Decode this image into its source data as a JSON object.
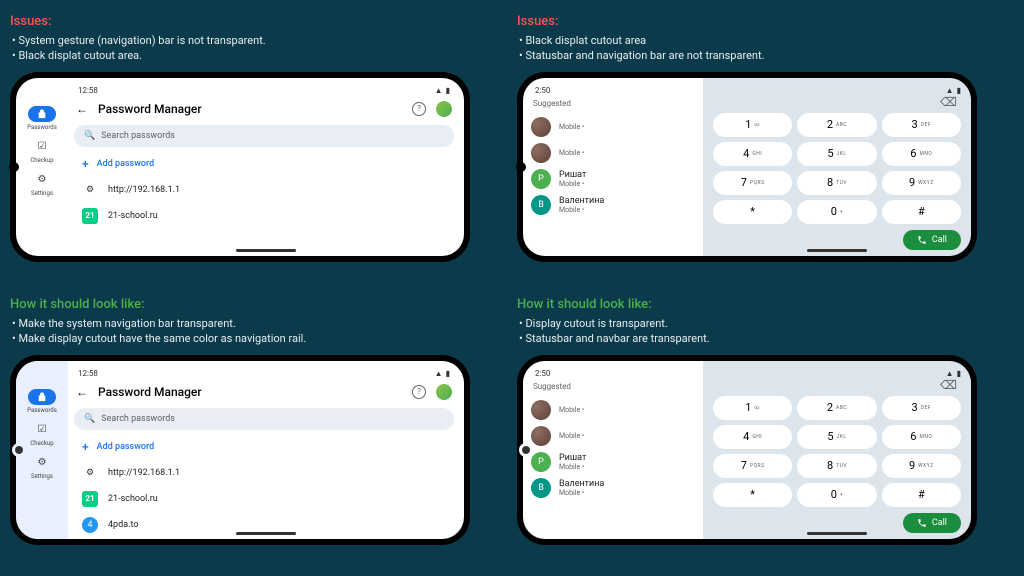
{
  "q1": {
    "heading": "Issues",
    "bullets": [
      "System gesture (navigation) bar is not transparent.",
      "Black displat cutout area."
    ]
  },
  "q2": {
    "heading": "Issues",
    "bullets": [
      "Black displat cutout area",
      "Statusbar and navigation bar are not transparent."
    ]
  },
  "q3": {
    "heading": "How it should look like",
    "bullets": [
      "Make the system navigation bar transparent.",
      "Make display cutout have the same color as navigation rail."
    ]
  },
  "q4": {
    "heading": "How it should look like",
    "bullets": [
      "Display cutout is transparent.",
      "Statusbar and navbar are transparent."
    ]
  },
  "pwdApp": {
    "time": "12:58",
    "title": "Password Manager",
    "search": "Search passwords",
    "add": "Add password",
    "rail": {
      "item1": "Passwords",
      "item2": "Checkup",
      "item3": "Settings"
    },
    "items": [
      {
        "name": "http://192.168.1.1"
      },
      {
        "name": "21-school.ru"
      },
      {
        "name": "4pda.to"
      }
    ]
  },
  "dialer": {
    "time": "2:50",
    "suggested": "Suggested",
    "mobile": "Mobile •",
    "contacts": [
      {
        "name": "",
        "type": "img"
      },
      {
        "name": "",
        "type": "img"
      },
      {
        "name": "Ришат",
        "type": "p",
        "letter": "P"
      },
      {
        "name": "Валентина",
        "type": "b",
        "letter": "В"
      }
    ],
    "keys": [
      {
        "n": "1",
        "l": "∞"
      },
      {
        "n": "2",
        "l": "ABC"
      },
      {
        "n": "3",
        "l": "DEF"
      },
      {
        "n": "4",
        "l": "GHI"
      },
      {
        "n": "5",
        "l": "JKL"
      },
      {
        "n": "6",
        "l": "MNO"
      },
      {
        "n": "7",
        "l": "PQRS"
      },
      {
        "n": "8",
        "l": "TUV"
      },
      {
        "n": "9",
        "l": "WXYZ"
      },
      {
        "n": "*",
        "l": ""
      },
      {
        "n": "0",
        "l": "+"
      },
      {
        "n": "#",
        "l": ""
      }
    ],
    "call": "Call"
  }
}
